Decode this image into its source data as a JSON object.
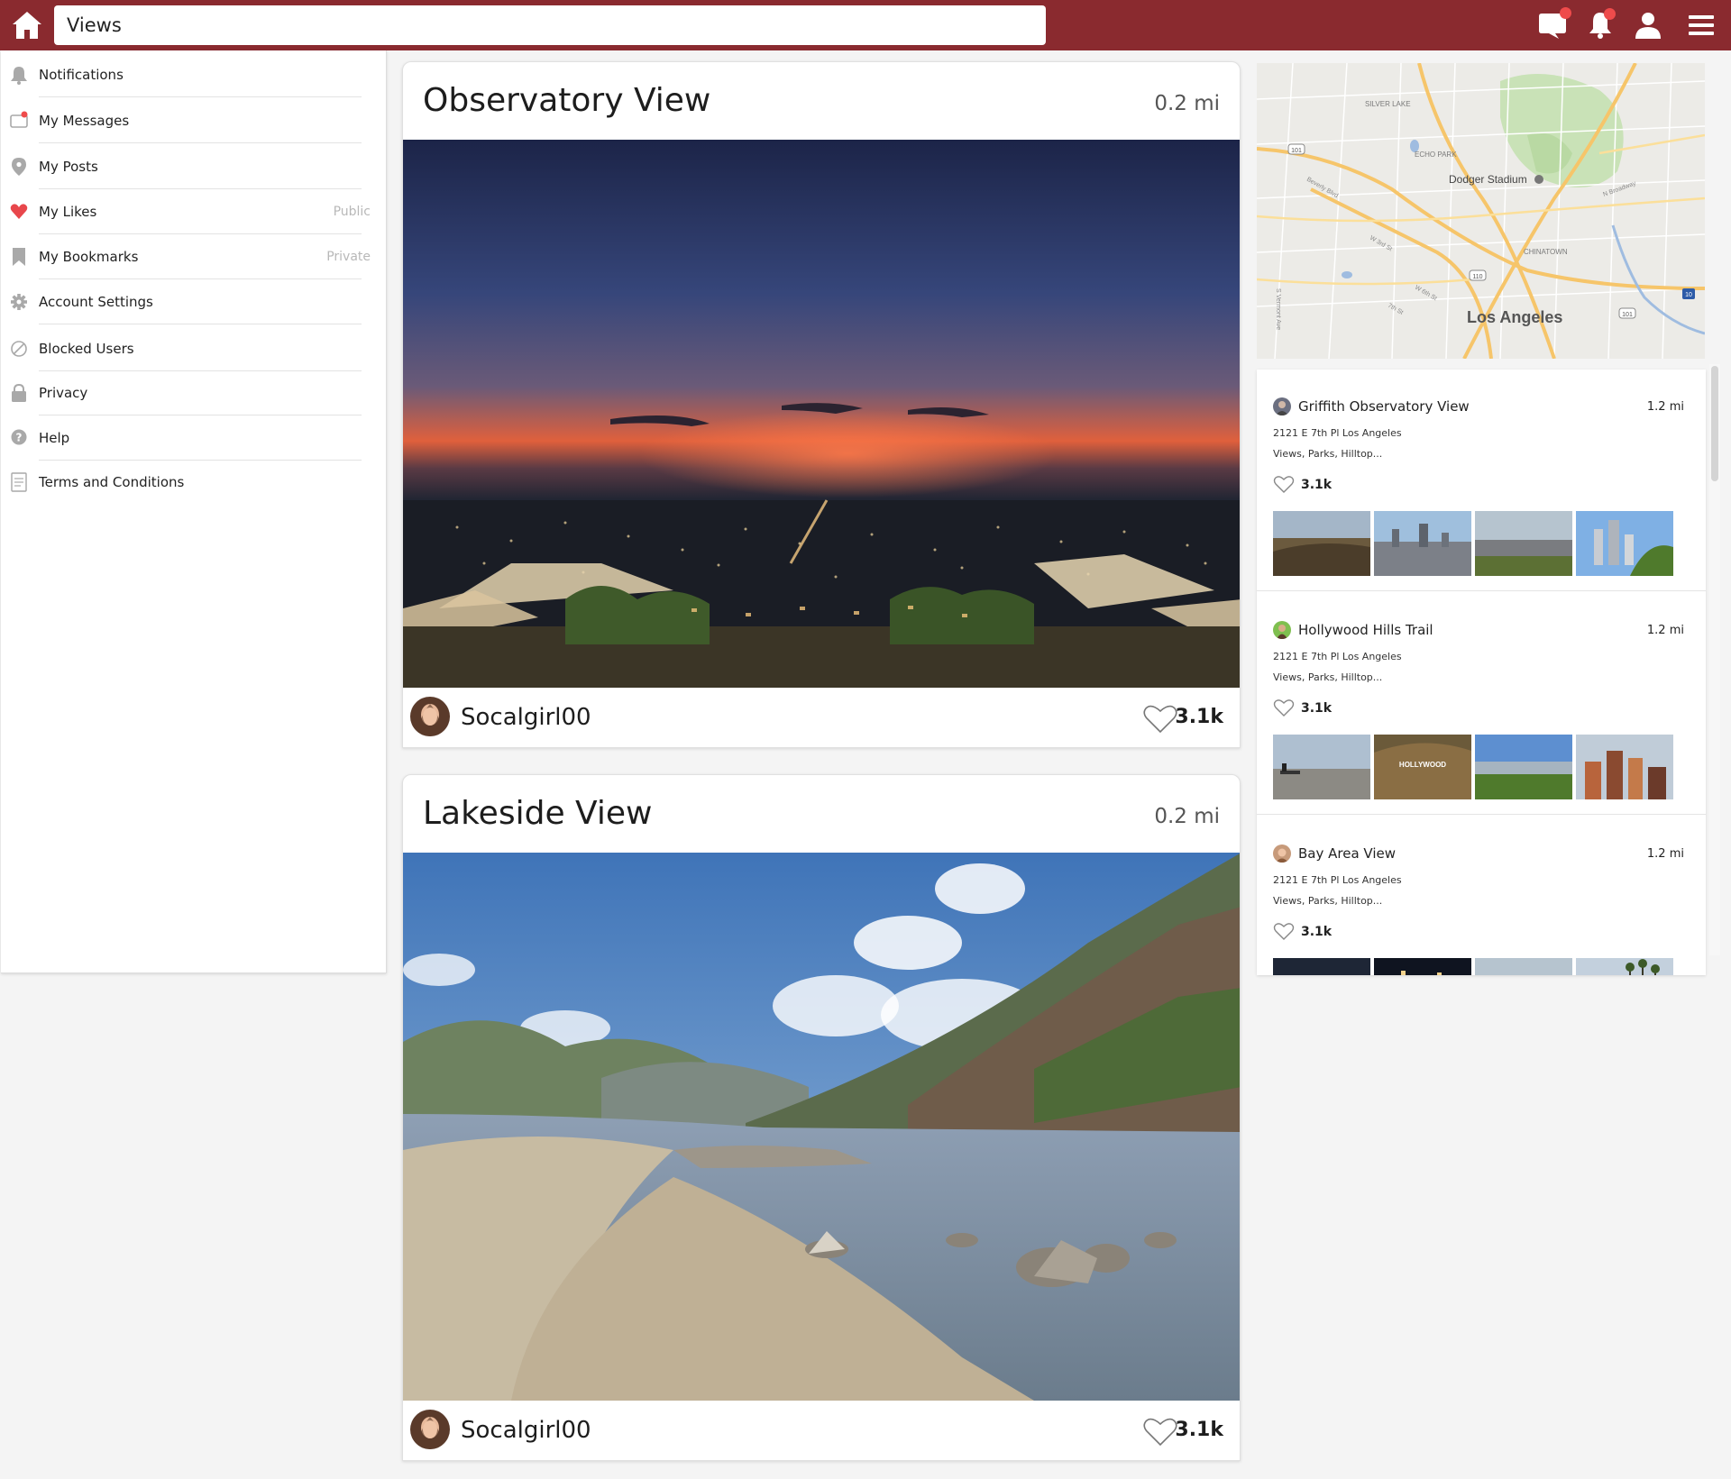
{
  "search": {
    "value": "Views"
  },
  "sidebar": {
    "items": [
      {
        "label": "Notifications",
        "meta": ""
      },
      {
        "label": "My Messages",
        "meta": ""
      },
      {
        "label": "My Posts",
        "meta": ""
      },
      {
        "label": "My Likes",
        "meta": "Public"
      },
      {
        "label": "My Bookmarks",
        "meta": "Private"
      },
      {
        "label": "Account Settings",
        "meta": ""
      },
      {
        "label": "Blocked Users",
        "meta": ""
      },
      {
        "label": "Privacy",
        "meta": ""
      },
      {
        "label": "Help",
        "meta": ""
      },
      {
        "label": "Terms and Conditions",
        "meta": ""
      }
    ]
  },
  "feed": {
    "posts": [
      {
        "title": "Observatory View",
        "distance": "0.2 mi",
        "username": "Socalgirl00",
        "likes": "3.1k"
      },
      {
        "title": "Lakeside View",
        "distance": "0.2 mi",
        "username": "Socalgirl00",
        "likes": "3.1k"
      }
    ]
  },
  "map": {
    "city": "Los Angeles",
    "labels": {
      "silver_lake": "SILVER LAKE",
      "echo_park": "ECHO PARK",
      "dodger": "Dodger Stadium",
      "chinatown": "CHINATOWN",
      "beverly": "Beverly Blvd",
      "w3rd": "W 3rd St",
      "w6th": "W 6th St",
      "s7th": "7th St",
      "vermont": "S Vermont Ave",
      "broadway": "N Broadway",
      "r101": "101",
      "r110": "110",
      "r10": "10"
    }
  },
  "places": [
    {
      "name": "Griffith Observatory View",
      "distance": "1.2 mi",
      "address": "2121 E 7th Pl Los Angeles",
      "tags": "Views, Parks, Hilltop...",
      "likes": "3.1k"
    },
    {
      "name": "Hollywood Hills Trail",
      "distance": "1.2 mi",
      "address": "2121 E 7th Pl Los Angeles",
      "tags": "Views, Parks, Hilltop...",
      "likes": "3.1k",
      "sign_text": "HOLLYWOOD"
    },
    {
      "name": "Bay Area View",
      "distance": "1.2 mi",
      "address": "2121 E 7th Pl Los Angeles",
      "tags": "Views, Parks, Hilltop...",
      "likes": "3.1k"
    }
  ],
  "colors": {
    "header": "#8a2a2f",
    "badge": "#ef4b4b",
    "like_red": "#e8474c"
  }
}
